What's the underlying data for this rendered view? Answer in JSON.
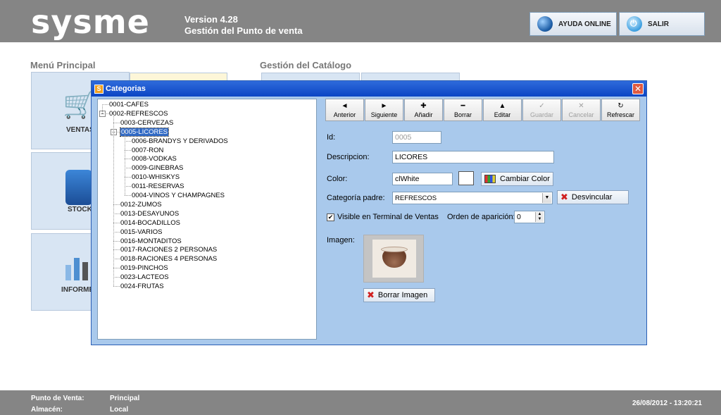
{
  "header": {
    "logo": "sysme",
    "version_line1": "Version 4.28",
    "version_line2": "Gestión del Punto de venta",
    "help_button": "AYUDA ONLINE",
    "exit_button": "SALIR"
  },
  "background": {
    "main_menu_title": "Menú Principal",
    "catalog_title": "Gestión del Catálogo",
    "tiles": [
      "VENTAS",
      "STOCK",
      "INFORMES"
    ]
  },
  "dialog": {
    "title": "Categorias",
    "tree": [
      {
        "label": "0001-CAFES",
        "level": 0
      },
      {
        "label": "0002-REFRESCOS",
        "level": 0,
        "expanded": true
      },
      {
        "label": "0003-CERVEZAS",
        "level": 1
      },
      {
        "label": "0005-LICORES",
        "level": 1,
        "expanded": true,
        "selected": true
      },
      {
        "label": "0006-BRANDYS Y DERIVADOS",
        "level": 2
      },
      {
        "label": "0007-RON",
        "level": 2
      },
      {
        "label": "0008-VODKAS",
        "level": 2
      },
      {
        "label": "0009-GINEBRAS",
        "level": 2
      },
      {
        "label": "0010-WHISKYS",
        "level": 2
      },
      {
        "label": "0011-RESERVAS",
        "level": 2
      },
      {
        "label": "0004-VINOS Y CHAMPAGNES",
        "level": 2
      },
      {
        "label": "0012-ZUMOS",
        "level": 1
      },
      {
        "label": "0013-DESAYUNOS",
        "level": 1
      },
      {
        "label": "0014-BOCADILLOS",
        "level": 1
      },
      {
        "label": "0015-VARIOS",
        "level": 1
      },
      {
        "label": "0016-MONTADITOS",
        "level": 1
      },
      {
        "label": "0017-RACIONES 2 PERSONAS",
        "level": 1
      },
      {
        "label": "0018-RACIONES 4 PERSONAS",
        "level": 1
      },
      {
        "label": "0019-PINCHOS",
        "level": 1
      },
      {
        "label": "0023-LACTEOS",
        "level": 1
      },
      {
        "label": "0024-FRUTAS",
        "level": 1
      }
    ],
    "toolbar": [
      {
        "label": "Anterior",
        "icon": "◄",
        "enabled": true,
        "name": "prev"
      },
      {
        "label": "Siguiente",
        "icon": "►",
        "enabled": true,
        "name": "next"
      },
      {
        "label": "Añadir",
        "icon": "✚",
        "enabled": true,
        "name": "add"
      },
      {
        "label": "Borrar",
        "icon": "━",
        "enabled": true,
        "name": "delete"
      },
      {
        "label": "Editar",
        "icon": "▲",
        "enabled": true,
        "name": "edit"
      },
      {
        "label": "Guardar",
        "icon": "✓",
        "enabled": false,
        "name": "save"
      },
      {
        "label": "Cancelar",
        "icon": "✕",
        "enabled": false,
        "name": "cancel"
      },
      {
        "label": "Refrescar",
        "icon": "↻",
        "enabled": true,
        "name": "refresh"
      }
    ],
    "form": {
      "id_label": "Id:",
      "id_value": "0005",
      "desc_label": "Descripcion:",
      "desc_value": "LICORES",
      "color_label": "Color:",
      "color_value": "clWhite",
      "change_color_button": "Cambiar Color",
      "parent_label": "Categoría padre:",
      "parent_value": "REFRESCOS",
      "unlink_button": "Desvincular",
      "visible_label": "Visible en Terminal de Ventas",
      "visible_checked": "✔",
      "order_label": "Orden de aparición:",
      "order_value": "0",
      "image_label": "Imagen:",
      "delete_image_button": "Borrar Imagen"
    }
  },
  "footer": {
    "pos_label": "Punto de Venta:",
    "pos_value": "Principal",
    "store_label": "Almacén:",
    "store_value": "Local",
    "datetime": "26/08/2012 - 13:20:21"
  }
}
